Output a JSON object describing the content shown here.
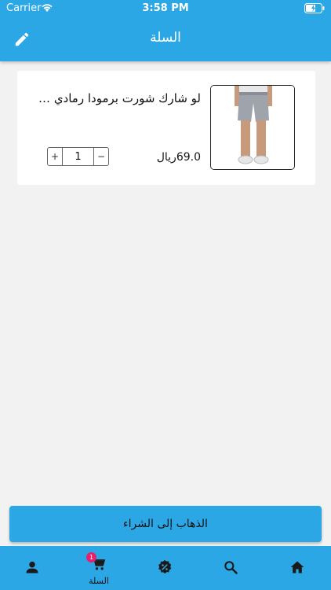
{
  "status_bar": {
    "carrier": "Carrier",
    "time": "3:58 PM"
  },
  "header": {
    "title": "السلة",
    "edit_icon": "pencil-icon"
  },
  "cart": {
    "items": [
      {
        "name": "لو شارك شورت برمودا رمادي -ر...",
        "price": "69.0ريال",
        "quantity": "1",
        "increment_label": "+",
        "decrement_label": "−"
      }
    ]
  },
  "checkout_label": "الذهاب إلى الشراء",
  "tabbar": {
    "cart_label": "السلة",
    "cart_badge": "1",
    "icons": [
      "person-icon",
      "cart-icon",
      "discount-icon",
      "search-icon",
      "home-icon"
    ]
  },
  "colors": {
    "accent": "#2ca7e6",
    "badge": "#e8206a",
    "background": "#f2f2f2"
  }
}
